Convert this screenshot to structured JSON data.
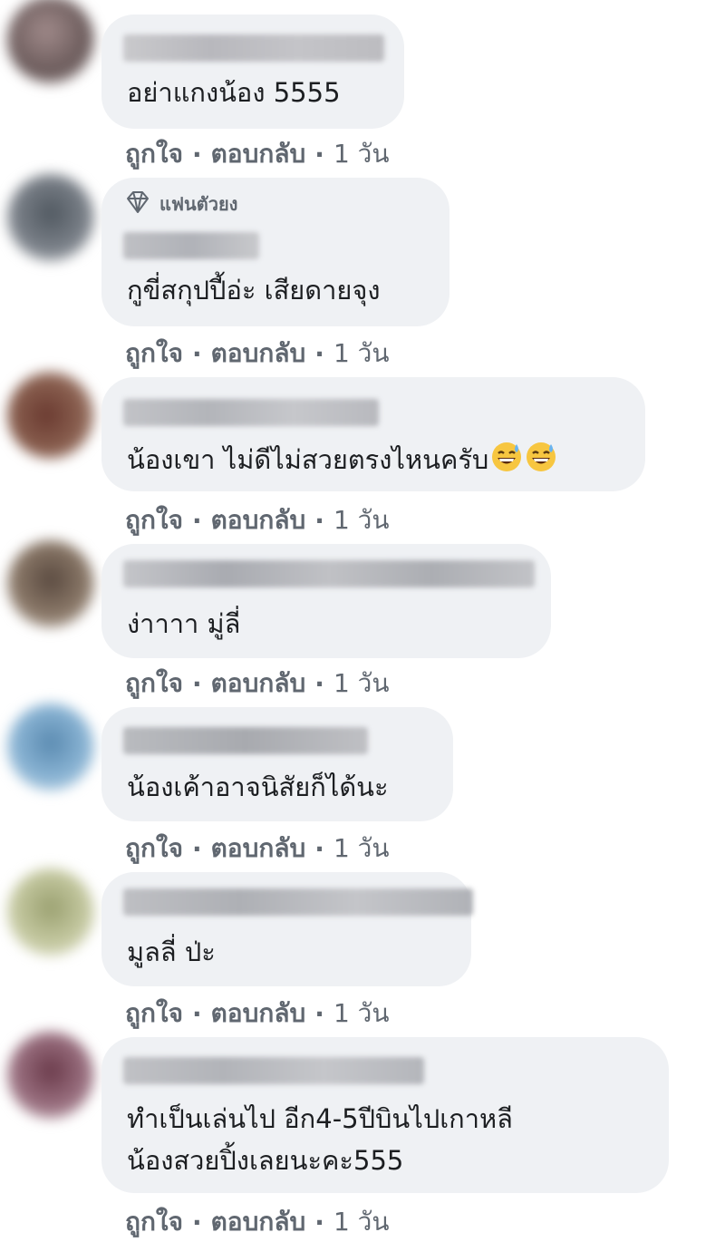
{
  "actions": {
    "like": "ถูกใจ",
    "reply": "ตอบกลับ",
    "sep": "·",
    "time": "1 วัน"
  },
  "fan_badge": {
    "label": "แฟนตัวยง",
    "icon": "diamond-icon"
  },
  "comments": [
    {
      "text": "อย่าแกงน้อง 5555"
    },
    {
      "text": "กูขี่สกุปปี้อ่ะ เสียดายจุง",
      "badge": "แฟนตัวยง"
    },
    {
      "text": "น้องเขา ไม่ดีไม่สวยตรงไหนครับ",
      "emoji": "grinning-sweat-face-icon"
    },
    {
      "text": "ง่าาาา มู่ลี่"
    },
    {
      "text": "น้องเค้าอาจนิสัยก็ได้นะ"
    },
    {
      "text": "มูลลี่ ป่ะ"
    },
    {
      "text_line1": "ทำเป็นเล่นไป อีก4-5ปีบินไปเกาหลี",
      "text_line2": "น้องสวยปิ้งเลยนะคะ555"
    }
  ],
  "colors": {
    "bubble": "#eff1f4",
    "meta": "#606770",
    "text": "#1c1e21"
  }
}
